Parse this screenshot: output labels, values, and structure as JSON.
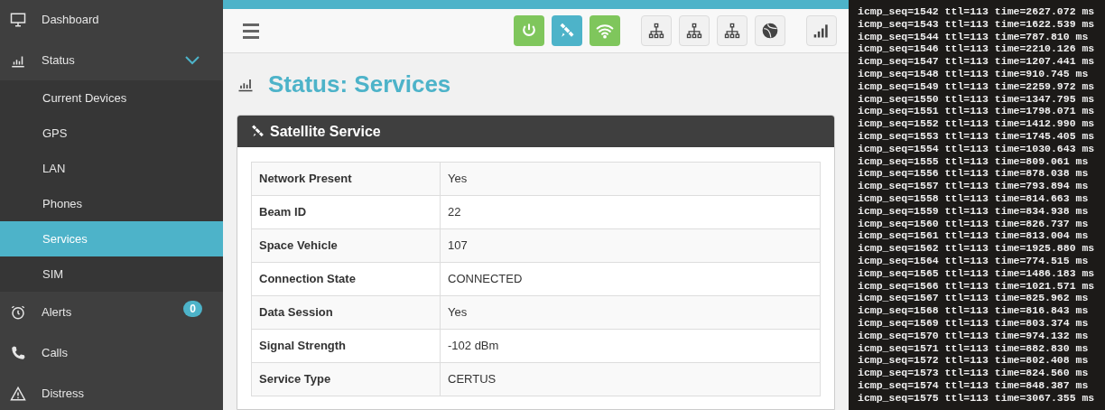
{
  "sidebar": {
    "items": [
      {
        "label": "Dashboard",
        "kind": "monitor",
        "selected": false
      },
      {
        "label": "Status",
        "kind": "chart",
        "selected": false,
        "expanded": true,
        "children": [
          {
            "label": "Current Devices",
            "selected": false
          },
          {
            "label": "GPS",
            "selected": false
          },
          {
            "label": "LAN",
            "selected": false
          },
          {
            "label": "Phones",
            "selected": false
          },
          {
            "label": "Services",
            "selected": true
          },
          {
            "label": "SIM",
            "selected": false
          }
        ]
      },
      {
        "label": "Alerts",
        "kind": "alarm",
        "selected": false,
        "badge": "0"
      },
      {
        "label": "Calls",
        "kind": "phone",
        "selected": false
      },
      {
        "label": "Distress",
        "kind": "warning",
        "selected": false
      }
    ]
  },
  "toolbar": {
    "buttons": [
      {
        "kind": "power",
        "color": "#7fc65c"
      },
      {
        "kind": "satellite",
        "color": "#4db3c9"
      },
      {
        "kind": "wifi",
        "color": "#7fc65c"
      },
      {
        "kind": "network",
        "color": "#f1f1f1"
      },
      {
        "kind": "network",
        "color": "#f1f1f1"
      },
      {
        "kind": "network",
        "color": "#f1f1f1"
      },
      {
        "kind": "globe",
        "color": "#f1f1f1"
      },
      {
        "kind": "signal",
        "color": "#f1f1f1"
      }
    ]
  },
  "page": {
    "title": "Status: Services"
  },
  "panel": {
    "title": "Satellite Service",
    "rows": [
      {
        "label": "Network Present",
        "value": "Yes"
      },
      {
        "label": "Beam ID",
        "value": "22"
      },
      {
        "label": "Space Vehicle",
        "value": "107"
      },
      {
        "label": "Connection State",
        "value": "CONNECTED"
      },
      {
        "label": "Data Session",
        "value": "Yes"
      },
      {
        "label": "Signal Strength",
        "value": "-102 dBm"
      },
      {
        "label": "Service Type",
        "value": "CERTUS"
      }
    ]
  },
  "terminal": {
    "lines": [
      "icmp_seq=1542 ttl=113 time=2627.072 ms",
      "icmp_seq=1543 ttl=113 time=1622.539 ms",
      "icmp_seq=1544 ttl=113 time=787.810 ms",
      "icmp_seq=1546 ttl=113 time=2210.126 ms",
      "icmp_seq=1547 ttl=113 time=1207.441 ms",
      "icmp_seq=1548 ttl=113 time=910.745 ms",
      "icmp_seq=1549 ttl=113 time=2259.972 ms",
      "icmp_seq=1550 ttl=113 time=1347.795 ms",
      "icmp_seq=1551 ttl=113 time=1798.071 ms",
      "icmp_seq=1552 ttl=113 time=1412.990 ms",
      "icmp_seq=1553 ttl=113 time=1745.405 ms",
      "icmp_seq=1554 ttl=113 time=1030.643 ms",
      "icmp_seq=1555 ttl=113 time=809.061 ms",
      "icmp_seq=1556 ttl=113 time=878.038 ms",
      "icmp_seq=1557 ttl=113 time=793.894 ms",
      "icmp_seq=1558 ttl=113 time=814.663 ms",
      "icmp_seq=1559 ttl=113 time=834.938 ms",
      "icmp_seq=1560 ttl=113 time=826.737 ms",
      "icmp_seq=1561 ttl=113 time=813.004 ms",
      "icmp_seq=1562 ttl=113 time=1925.880 ms",
      "icmp_seq=1564 ttl=113 time=774.515 ms",
      "icmp_seq=1565 ttl=113 time=1486.183 ms",
      "icmp_seq=1566 ttl=113 time=1021.571 ms",
      "icmp_seq=1567 ttl=113 time=825.962 ms",
      "icmp_seq=1568 ttl=113 time=816.843 ms",
      "icmp_seq=1569 ttl=113 time=803.374 ms",
      "icmp_seq=1570 ttl=113 time=974.132 ms",
      "icmp_seq=1571 ttl=113 time=882.830 ms",
      "icmp_seq=1572 ttl=113 time=802.408 ms",
      "icmp_seq=1573 ttl=113 time=824.560 ms",
      "icmp_seq=1574 ttl=113 time=848.387 ms",
      "icmp_seq=1575 ttl=113 time=3067.355 ms"
    ]
  }
}
